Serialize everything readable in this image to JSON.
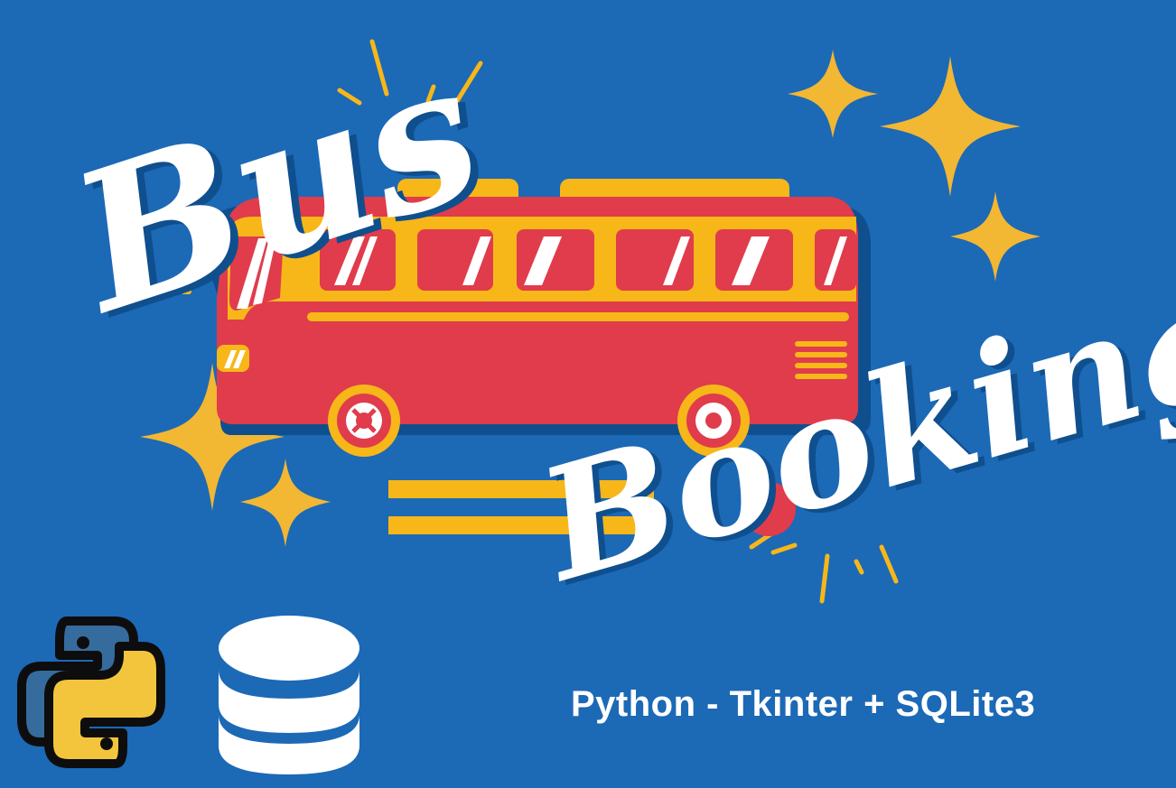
{
  "banner": {
    "title_word_1": "Bus",
    "title_word_2": "Booking",
    "subtitle": "Python - Tkinter + SQLite3"
  },
  "icons": {
    "illustration": "bus-icon",
    "sparkles": "sparkle-icon",
    "language": "python-logo-icon",
    "database": "database-icon"
  },
  "colors": {
    "background": "#1c69b6",
    "bus_red": "#e03c4c",
    "accent_yellow": "#f7b719",
    "sparkle": "#f2b733",
    "text_white": "#ffffff",
    "python_blue": "#366b9e",
    "python_yellow": "#f2c53d",
    "outline": "#0d0d0d"
  }
}
